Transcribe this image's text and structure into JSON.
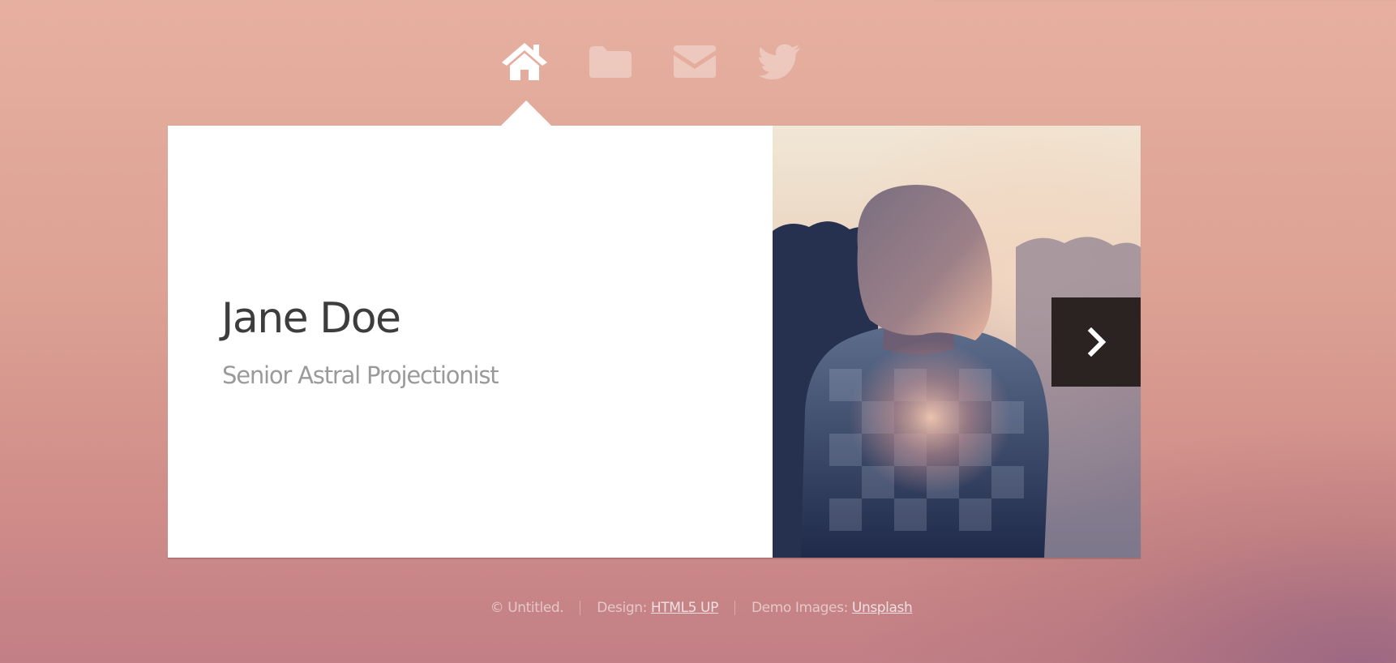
{
  "nav": {
    "items": [
      {
        "icon": "home-icon",
        "state": "active"
      },
      {
        "icon": "folder-icon",
        "state": "inactive"
      },
      {
        "icon": "envelope-icon",
        "state": "inactive"
      },
      {
        "icon": "twitter-icon",
        "state": "inactive"
      }
    ]
  },
  "intro": {
    "name": "Jane Doe",
    "role": "Senior Astral Projectionist"
  },
  "photo": {
    "alt_icon": "woman-silhouette-photo",
    "next_icon": "chevron-right-icon"
  },
  "footer": {
    "copyright": "© Untitled.",
    "design_label": "Design:",
    "design_link": "HTML5 UP",
    "images_label": "Demo Images:",
    "images_link": "Unsplash"
  },
  "colors": {
    "background_top": "#e6b0a0",
    "background_bottom": "#c27f86",
    "panel": "#ffffff",
    "name_text": "#3d3d3d",
    "role_text": "#9a9a9a",
    "next_button": "#2b2322"
  }
}
